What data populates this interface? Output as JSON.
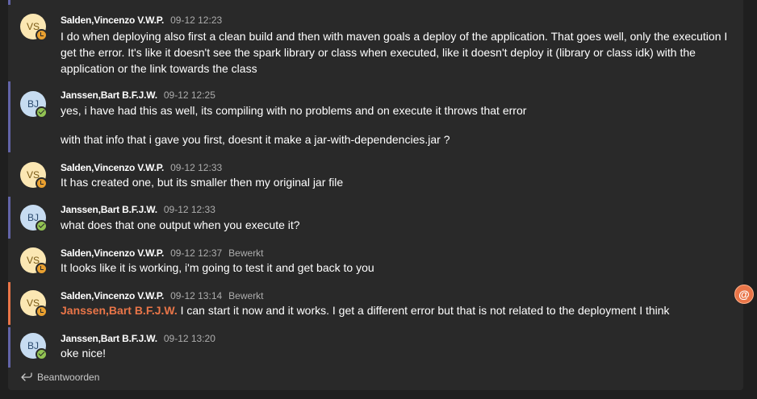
{
  "messages": [
    {
      "initials": "VS",
      "author": "Salden,Vincenzo V.W.P.",
      "time": "09-12 12:23",
      "edited": "",
      "paragraphs": [
        "I do when deploying also first a clean build and then with maven goals a deploy of the application. That goes well, only the execution I get the error. It's like it doesn't see the spark library or class when executed, like it doesn't deploy it (library or class idk) with the application or the link towards the class"
      ]
    },
    {
      "initials": "BJ",
      "author": "Janssen,Bart B.F.J.W.",
      "time": "09-12 12:25",
      "edited": "",
      "paragraphs": [
        "yes, i have had this as well, its compiling with no problems and on execute it throws that error",
        "with that info that i gave you first, doesnt it make a jar-with-dependencies.jar ?"
      ]
    },
    {
      "initials": "VS",
      "author": "Salden,Vincenzo V.W.P.",
      "time": "09-12 12:33",
      "edited": "",
      "paragraphs": [
        "It has created one, but its smaller then my original jar file"
      ]
    },
    {
      "initials": "BJ",
      "author": "Janssen,Bart B.F.J.W.",
      "time": "09-12 12:33",
      "edited": "",
      "paragraphs": [
        "what does that one output when you execute it?"
      ]
    },
    {
      "initials": "VS",
      "author": "Salden,Vincenzo V.W.P.",
      "time": "09-12 12:37",
      "edited": "Bewerkt",
      "paragraphs": [
        "It looks like it is working, i'm going to test it and get back to you"
      ]
    },
    {
      "initials": "VS",
      "author": "Salden,Vincenzo V.W.P.",
      "time": "09-12 13:14",
      "edited": "Bewerkt",
      "mention": "Janssen,Bart B.F.J.W.",
      "paragraphs": [
        "I can start it now and it works.  I get a different error but that is not related to the deployment I think"
      ]
    },
    {
      "initials": "BJ",
      "author": "Janssen,Bart B.F.J.W.",
      "time": "09-12 13:20",
      "edited": "",
      "paragraphs": [
        "oke nice!"
      ]
    }
  ],
  "reply_label": "Beantwoorden",
  "mention_badge": "@",
  "colors": {
    "accent": "#6264a7",
    "mention": "#e97548",
    "away": "#e9a030",
    "available": "#92c353"
  }
}
